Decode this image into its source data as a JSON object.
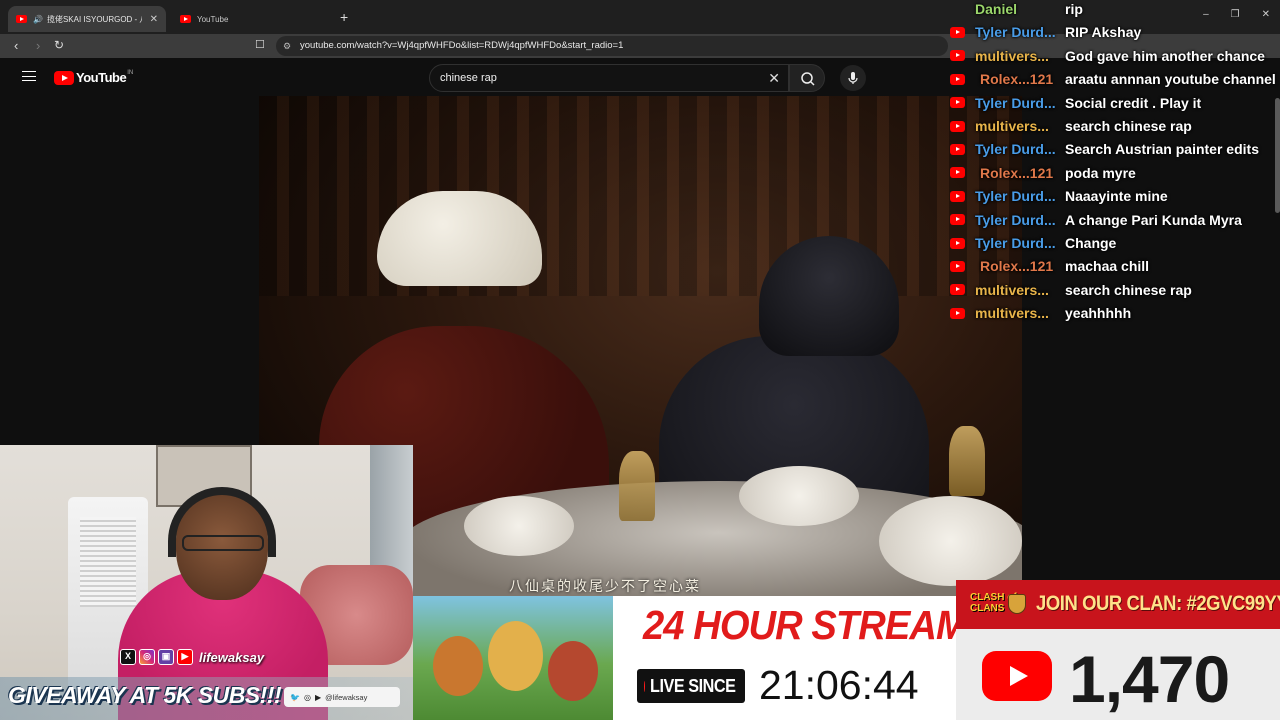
{
  "browser": {
    "tabs": [
      {
        "title": "揽佬SKAI ISYOURGOD - 八方"
      },
      {
        "title": "YouTube"
      }
    ],
    "new_tab_label": "+",
    "url": "youtube.com/watch?v=Wj4qpfWHFDo&list=RDWj4qpfWHFDo&start_radio=1",
    "window_controls": [
      "–",
      "❐",
      "✕"
    ]
  },
  "youtube": {
    "logo_text": "YouTube",
    "region": "IN",
    "search_value": "chinese rap"
  },
  "video": {
    "subtitle": "八仙桌的收尾少不了空心菜"
  },
  "chat": {
    "name_colors": {
      "Daniel": "#9bd66b",
      "Tyler": "#4a9de8",
      "multivers": "#e8b44a",
      "Rolex": "#e0784a"
    },
    "messages": [
      {
        "author": "Daniel",
        "kind": "Daniel",
        "text": "rip"
      },
      {
        "author": "Tyler Durd...",
        "kind": "Tyler",
        "text": "RIP Akshay"
      },
      {
        "author": "multivers...",
        "kind": "multivers",
        "text": "God gave him another chance"
      },
      {
        "author": "Rolex...121",
        "kind": "Rolex",
        "text": "araatu annnan youtube channel"
      },
      {
        "author": "Tyler Durd...",
        "kind": "Tyler",
        "text": "Social credit . Play it"
      },
      {
        "author": "multivers...",
        "kind": "multivers",
        "text": "search chinese rap"
      },
      {
        "author": "Tyler Durd...",
        "kind": "Tyler",
        "text": "Search Austrian painter edits"
      },
      {
        "author": "Rolex...121",
        "kind": "Rolex",
        "text": "poda myre"
      },
      {
        "author": "Tyler Durd...",
        "kind": "Tyler",
        "text": "Naaayinte mine"
      },
      {
        "author": "Tyler Durd...",
        "kind": "Tyler",
        "text": "A change Pari Kunda Myra"
      },
      {
        "author": "Tyler Durd...",
        "kind": "Tyler",
        "text": "Change"
      },
      {
        "author": "Rolex...121",
        "kind": "Rolex",
        "text": "machaa chill"
      },
      {
        "author": "multivers...",
        "kind": "multivers",
        "text": "search chinese rap"
      },
      {
        "author": "multivers...",
        "kind": "multivers",
        "text": "yeahhhhh"
      }
    ]
  },
  "webcam": {
    "social_handle": "lifewaksay",
    "giveaway": "GIVEAWAY AT 5K SUBS!!!",
    "handle_small": "@lifewaksay"
  },
  "overlay": {
    "stream_title": "24 HOUR STREAM",
    "live_label": "LIVE SINCE",
    "live_timer": "21:06:44",
    "clan_logo": "CLASH of CLANS",
    "clan_text": "JOIN OUR CLAN: #2GVC99YY8",
    "subscriber_count": "1,470"
  },
  "colors": {
    "stream_title": "#e11b1b",
    "clan_banner": "#c8141c",
    "youtube_red": "#ff0000"
  }
}
